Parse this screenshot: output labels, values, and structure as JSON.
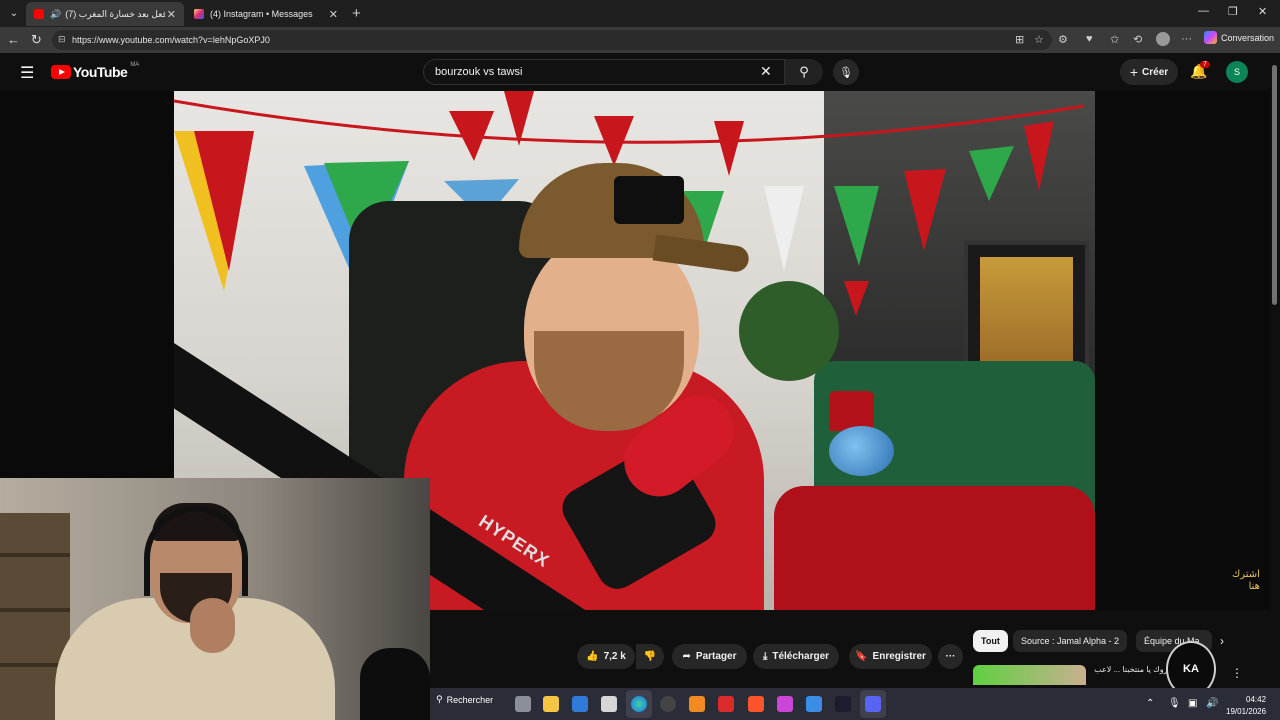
{
  "browser": {
    "tabs": [
      {
        "title": "(7) ردة فعل بعد خسارة المغرب",
        "active": true
      },
      {
        "title": "(4) Instagram • Messages",
        "active": false
      }
    ],
    "url": "https://www.youtube.com/watch?v=lehNpGoXPJ0",
    "conversation_label": "Conversation"
  },
  "youtube": {
    "logo_text": "YouTube",
    "country_code": "MA",
    "search_value": "bourzouk vs tawsi",
    "create_label": "Créer",
    "notification_count": "7",
    "avatar_letter": "S"
  },
  "video": {
    "overlay_text_line1": "اشترك",
    "overlay_text_line2": "هنا",
    "mic_brand": "HYPERX"
  },
  "actions": {
    "like_count": "7,2 k",
    "share_label": "Partager",
    "download_label": "Télécharger",
    "save_label": "Enregistrer"
  },
  "chips": [
    "Tout",
    "Source : Jamal Alpha - 2",
    "Équipe du Ma"
  ],
  "recommendation": {
    "title": "المغرب مبروك يا منتخبنا ... لاعب 0"
  },
  "channel_badge": "KA",
  "taskbar": {
    "search_label": "Rechercher",
    "time": "04:42",
    "date": "19/01/2026"
  },
  "colors": {
    "yt_red": "#ff0000",
    "bg": "#0f0f0f",
    "avatar_green": "#0b8457",
    "badge_red": "#cc0000"
  }
}
